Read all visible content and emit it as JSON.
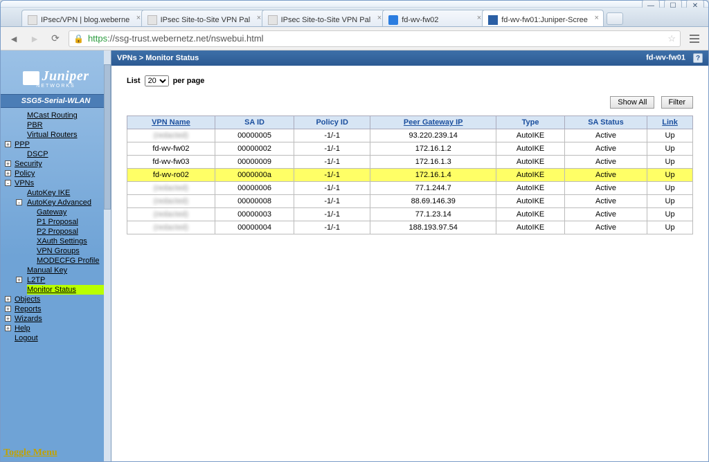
{
  "window": {
    "tabs": [
      {
        "title": "IPsec/VPN | blog.weberne"
      },
      {
        "title": "IPsec Site-to-Site VPN Pal"
      },
      {
        "title": "IPsec Site-to-Site VPN Pal"
      },
      {
        "title": "fd-wv-fw02"
      },
      {
        "title": "fd-wv-fw01:Juniper-Scree"
      }
    ],
    "min": "—",
    "max": "☐",
    "close": "✕"
  },
  "address": {
    "https": "https",
    "url_rest": "://ssg-trust.webernetz.net/nswebui.html"
  },
  "topbar": {
    "breadcrumb": "VPNs > Monitor Status",
    "hostname": "fd-wv-fw01",
    "help": "?"
  },
  "sidebar": {
    "brand": "Juniper",
    "brand_sub": "NETWORKS",
    "device": "SSG5-Serial-WLAN",
    "items": {
      "mcast": "MCast Routing",
      "pbr": "PBR",
      "vrouters": "Virtual Routers",
      "ppp": "PPP",
      "dscp": "DSCP",
      "security": "Security",
      "policy": "Policy",
      "vpns": "VPNs",
      "autokey_ike": "AutoKey IKE",
      "autokey_adv": "AutoKey Advanced",
      "gateway": "Gateway",
      "p1": "P1 Proposal",
      "p2": "P2 Proposal",
      "xauth": "XAuth Settings",
      "vpn_groups": "VPN Groups",
      "modecfg": "MODECFG Profile",
      "manual_key": "Manual Key",
      "l2tp": "L2TP",
      "monitor_status": "Monitor Status",
      "objects": "Objects",
      "reports": "Reports",
      "wizards": "Wizards",
      "help_item": "Help",
      "logout": "Logout"
    },
    "toggle": "Toggle Menu"
  },
  "list_controls": {
    "list_label": "List",
    "per_page_value": "20",
    "per_page_label": "per page",
    "show_all": "Show All",
    "filter": "Filter"
  },
  "table": {
    "headers": {
      "vpn_name": "VPN Name",
      "sa_id": "SA ID",
      "policy_id": "Policy ID",
      "peer_gateway": "Peer Gateway IP",
      "type": "Type",
      "sa_status": "SA Status",
      "link": "Link"
    },
    "rows": [
      {
        "name": "(redacted)",
        "sa": "00000005",
        "policy": "-1/-1",
        "peer": "93.220.239.14",
        "type": "AutoIKE",
        "status": "Active",
        "link": "Up",
        "blur": true,
        "hl": false
      },
      {
        "name": "fd-wv-fw02",
        "sa": "00000002",
        "policy": "-1/-1",
        "peer": "172.16.1.2",
        "type": "AutoIKE",
        "status": "Active",
        "link": "Up",
        "blur": false,
        "hl": false
      },
      {
        "name": "fd-wv-fw03",
        "sa": "00000009",
        "policy": "-1/-1",
        "peer": "172.16.1.3",
        "type": "AutoIKE",
        "status": "Active",
        "link": "Up",
        "blur": false,
        "hl": false
      },
      {
        "name": "fd-wv-ro02",
        "sa": "0000000a",
        "policy": "-1/-1",
        "peer": "172.16.1.4",
        "type": "AutoIKE",
        "status": "Active",
        "link": "Up",
        "blur": false,
        "hl": true
      },
      {
        "name": "(redacted)",
        "sa": "00000006",
        "policy": "-1/-1",
        "peer": "77.1.244.7",
        "type": "AutoIKE",
        "status": "Active",
        "link": "Up",
        "blur": true,
        "hl": false
      },
      {
        "name": "(redacted)",
        "sa": "00000008",
        "policy": "-1/-1",
        "peer": "88.69.146.39",
        "type": "AutoIKE",
        "status": "Active",
        "link": "Up",
        "blur": true,
        "hl": false
      },
      {
        "name": "(redacted)",
        "sa": "00000003",
        "policy": "-1/-1",
        "peer": "77.1.23.14",
        "type": "AutoIKE",
        "status": "Active",
        "link": "Up",
        "blur": true,
        "hl": false
      },
      {
        "name": "(redacted)",
        "sa": "00000004",
        "policy": "-1/-1",
        "peer": "188.193.97.54",
        "type": "AutoIKE",
        "status": "Active",
        "link": "Up",
        "blur": true,
        "hl": false
      }
    ]
  }
}
